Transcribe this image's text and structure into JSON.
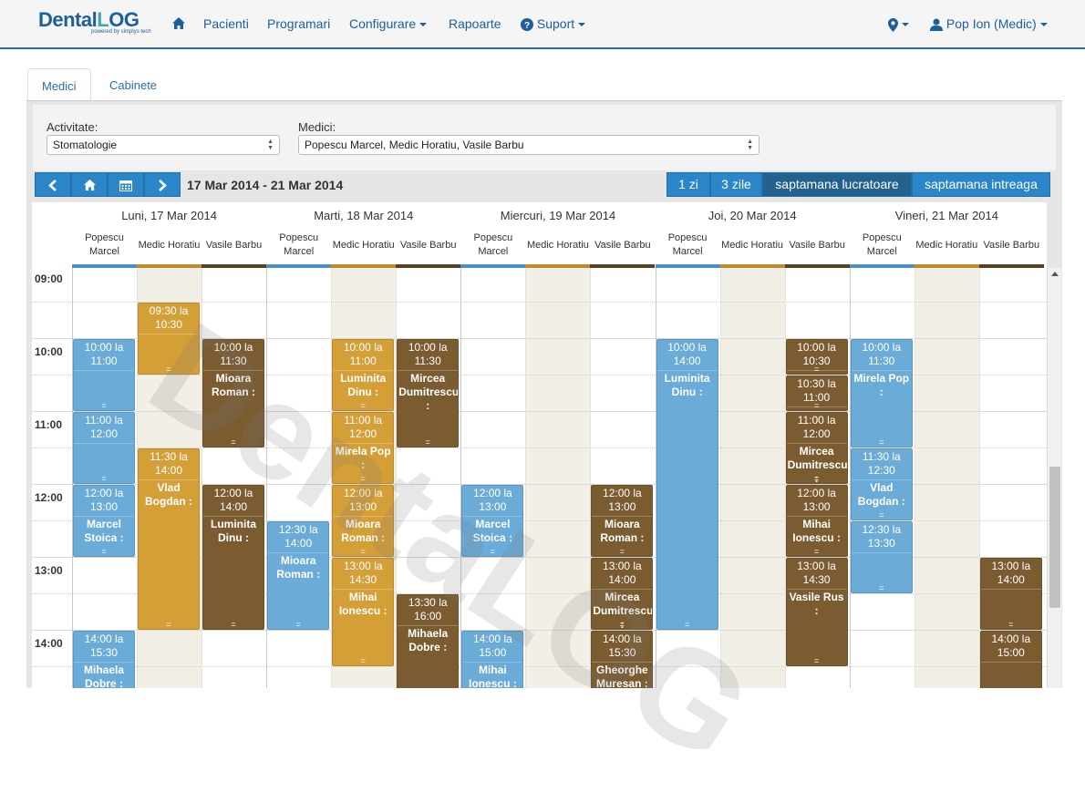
{
  "brand": {
    "name_a": "Dental",
    "name_b": "L",
    "name_c": "OG",
    "tagline": "powered by simplys tech"
  },
  "nav": {
    "home_icon": "home-icon",
    "items": [
      "Pacienti",
      "Programari",
      "Configurare",
      "Rapoarte",
      "Suport"
    ],
    "location_icon": "map-marker-icon",
    "user": "Pop Ion (Medic)"
  },
  "tabs": [
    "Medici",
    "Cabinete"
  ],
  "filters": {
    "activity_label": "Activitate:",
    "activity_value": "Stomatologie",
    "doctors_label": "Medici:",
    "doctors_value": "Popescu Marcel, Medic Horatiu, Vasile Barbu"
  },
  "toolbar": {
    "prev_icon": "chevron-left-icon",
    "today_icon": "home-icon",
    "calendar_icon": "calendar-icon",
    "next_icon": "chevron-right-icon",
    "date_range": "17 Mar 2014 - 21 Mar 2014",
    "views": [
      "1 zi",
      "3 zile",
      "saptamana lucratoare",
      "saptamana intreaga"
    ],
    "active_view": "saptamana lucratoare"
  },
  "colors": {
    "blue": "#6aabd7",
    "gold": "#d59f38",
    "brown": "#7b5c30",
    "accent": "#2a85c9"
  },
  "calendar": {
    "days": [
      "Luni, 17 Mar 2014",
      "Marti, 18 Mar 2014",
      "Miercuri, 19 Mar 2014",
      "Joi, 20 Mar 2014",
      "Vineri, 21 Mar 2014"
    ],
    "doctors": [
      {
        "line1": "Popescu",
        "line2": "Marcel",
        "color": "blue"
      },
      {
        "line1": "Medic Horatiu",
        "line2": "",
        "color": "gold"
      },
      {
        "line1": "Vasile Barbu",
        "line2": "",
        "color": "brown"
      }
    ],
    "hours": [
      "09:00",
      "10:00",
      "11:00",
      "12:00",
      "13:00",
      "14:00"
    ],
    "watermark": "DentaLOG",
    "events": [
      {
        "day": 0,
        "doc": 0,
        "start": "10:00",
        "end": "11:00",
        "time": "10:00 la 11:00",
        "name": ""
      },
      {
        "day": 0,
        "doc": 0,
        "start": "11:00",
        "end": "12:00",
        "time": "11:00 la 12:00",
        "name": ""
      },
      {
        "day": 0,
        "doc": 0,
        "start": "12:00",
        "end": "13:00",
        "time": "12:00 la 13:00",
        "name": "Marcel Stoica :"
      },
      {
        "day": 0,
        "doc": 0,
        "start": "14:00",
        "end": "15:30",
        "time": "14:00 la 15:30",
        "name": "Mihaela Dobre :"
      },
      {
        "day": 0,
        "doc": 1,
        "start": "09:30",
        "end": "10:30",
        "time": "09:30 la 10:30",
        "name": ""
      },
      {
        "day": 0,
        "doc": 1,
        "start": "11:30",
        "end": "14:00",
        "time": "11:30 la 14:00",
        "name": "Vlad Bogdan :"
      },
      {
        "day": 0,
        "doc": 2,
        "start": "10:00",
        "end": "11:30",
        "time": "10:00 la 11:30",
        "name": "Mioara Roman :"
      },
      {
        "day": 0,
        "doc": 2,
        "start": "12:00",
        "end": "14:00",
        "time": "12:00 la 14:00",
        "name": "Luminita Dinu :"
      },
      {
        "day": 1,
        "doc": 0,
        "start": "12:30",
        "end": "14:00",
        "time": "12:30 la 14:00",
        "name": "Mioara Roman :"
      },
      {
        "day": 1,
        "doc": 1,
        "start": "10:00",
        "end": "11:00",
        "time": "10:00 la 11:00",
        "name": "Luminita Dinu :"
      },
      {
        "day": 1,
        "doc": 1,
        "start": "11:00",
        "end": "12:00",
        "time": "11:00 la 12:00",
        "name": "Mirela Pop :"
      },
      {
        "day": 1,
        "doc": 1,
        "start": "12:00",
        "end": "13:00",
        "time": "12:00 la 13:00",
        "name": "Mioara Roman :"
      },
      {
        "day": 1,
        "doc": 1,
        "start": "13:00",
        "end": "14:30",
        "time": "13:00 la 14:30",
        "name": "Mihai Ionescu :"
      },
      {
        "day": 1,
        "doc": 2,
        "start": "10:00",
        "end": "11:30",
        "time": "10:00 la 11:30",
        "name": "Mircea Dumitrescu :"
      },
      {
        "day": 1,
        "doc": 2,
        "start": "13:30",
        "end": "16:00",
        "time": "13:30 la 16:00",
        "name": "Mihaela Dobre :"
      },
      {
        "day": 2,
        "doc": 0,
        "start": "12:00",
        "end": "13:00",
        "time": "12:00 la 13:00",
        "name": "Marcel Stoica :"
      },
      {
        "day": 2,
        "doc": 0,
        "start": "14:00",
        "end": "15:00",
        "time": "14:00 la 15:00",
        "name": "Mihai Ionescu :"
      },
      {
        "day": 2,
        "doc": 2,
        "start": "12:00",
        "end": "13:00",
        "time": "12:00 la 13:00",
        "name": "Mioara Roman :"
      },
      {
        "day": 2,
        "doc": 2,
        "start": "13:00",
        "end": "14:00",
        "time": "13:00 la 14:00",
        "name": "Mircea Dumitrescu :"
      },
      {
        "day": 2,
        "doc": 2,
        "start": "14:00",
        "end": "15:30",
        "time": "14:00 la 15:30",
        "name": "Gheorghe Muresan :"
      },
      {
        "day": 3,
        "doc": 0,
        "start": "10:00",
        "end": "14:00",
        "time": "10:00 la 14:00",
        "name": "Luminita Dinu :"
      },
      {
        "day": 3,
        "doc": 2,
        "start": "10:00",
        "end": "10:30",
        "time": "10:00 la 10:30",
        "name": ""
      },
      {
        "day": 3,
        "doc": 2,
        "start": "10:30",
        "end": "11:00",
        "time": "10:30 la 11:00",
        "name": ""
      },
      {
        "day": 3,
        "doc": 2,
        "start": "11:00",
        "end": "12:00",
        "time": "11:00 la 12:00",
        "name": "Mircea Dumitrescu :"
      },
      {
        "day": 3,
        "doc": 2,
        "start": "12:00",
        "end": "13:00",
        "time": "12:00 la 13:00",
        "name": "Mihai Ionescu :"
      },
      {
        "day": 3,
        "doc": 2,
        "start": "13:00",
        "end": "14:30",
        "time": "13:00 la 14:30",
        "name": "Vasile Rus :"
      },
      {
        "day": 4,
        "doc": 0,
        "start": "10:00",
        "end": "11:30",
        "time": "10:00 la 11:30",
        "name": "Mirela Pop :"
      },
      {
        "day": 4,
        "doc": 0,
        "start": "11:30",
        "end": "12:30",
        "time": "11:30 la 12:30",
        "name": "Vlad Bogdan :"
      },
      {
        "day": 4,
        "doc": 0,
        "start": "12:30",
        "end": "13:30",
        "time": "12:30 la 13:30",
        "name": ""
      },
      {
        "day": 4,
        "doc": 2,
        "start": "13:00",
        "end": "14:00",
        "time": "13:00 la 14:00",
        "name": ""
      },
      {
        "day": 4,
        "doc": 2,
        "start": "14:00",
        "end": "15:00",
        "time": "14:00 la 15:00",
        "name": ""
      }
    ]
  }
}
